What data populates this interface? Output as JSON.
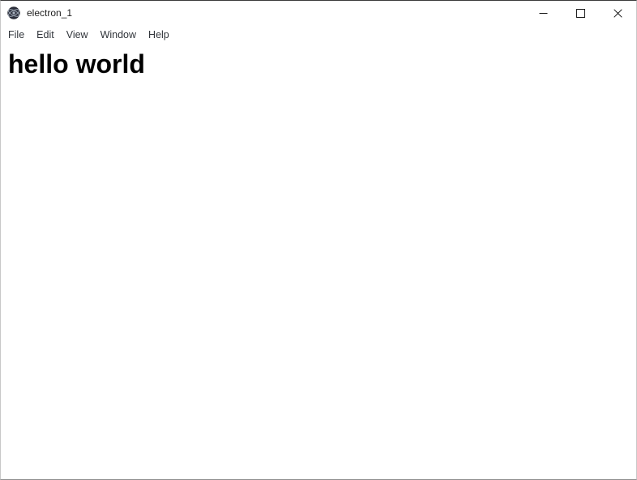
{
  "window": {
    "title": "electron_1",
    "app_icon": "electron-logo-icon",
    "background_color": "#ffffff",
    "border_color": "#c8c8c8",
    "controls": [
      {
        "name": "minimize",
        "label": "Minimize",
        "glyph": "minimize-icon"
      },
      {
        "name": "maximize",
        "label": "Maximize",
        "glyph": "maximize-icon"
      },
      {
        "name": "close",
        "label": "Close",
        "glyph": "close-icon"
      }
    ]
  },
  "menu_bar": {
    "items": [
      {
        "label": "File"
      },
      {
        "label": "Edit"
      },
      {
        "label": "View"
      },
      {
        "label": "Window"
      },
      {
        "label": "Help"
      }
    ]
  },
  "content": {
    "heading": "hello world",
    "text_color": "#000000"
  }
}
